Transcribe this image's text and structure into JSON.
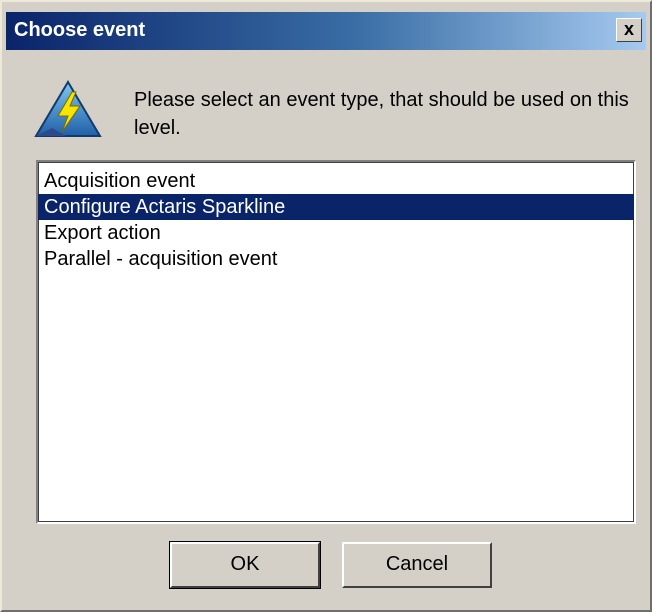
{
  "window": {
    "title": "Choose event",
    "close_symbol": "x"
  },
  "icon": "event-lightning-icon",
  "prompt": "Please select an event type, that should be used on this level.",
  "list": {
    "items": [
      {
        "label": "Acquisition event",
        "selected": false
      },
      {
        "label": "Configure Actaris Sparkline",
        "selected": true
      },
      {
        "label": "Export action",
        "selected": false
      },
      {
        "label": "Parallel - acquisition event",
        "selected": false
      }
    ]
  },
  "buttons": {
    "ok_label": "OK",
    "cancel_label": "Cancel"
  },
  "colors": {
    "title_bar": "#0a246a",
    "selection": "#0a246a",
    "face": "#d4d0c8"
  }
}
